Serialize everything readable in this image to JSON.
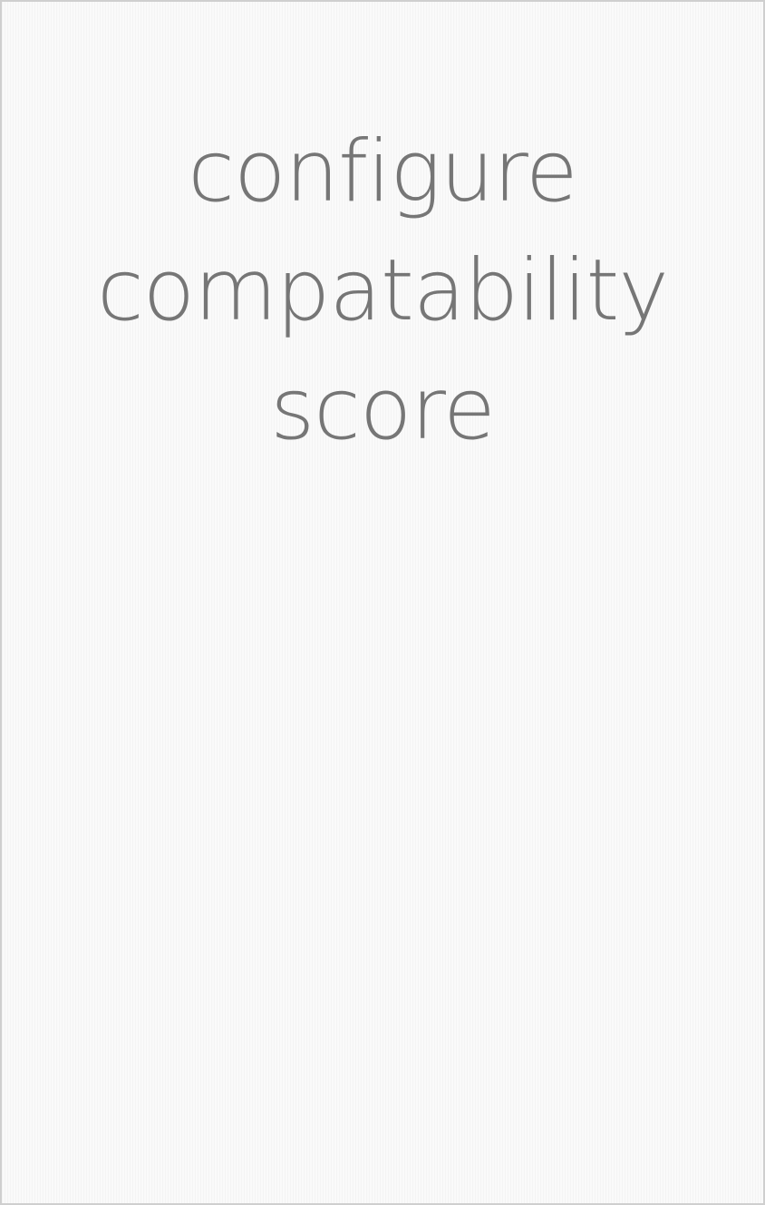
{
  "screen": {
    "title_lines": [
      "configure",
      "compatability",
      "score"
    ]
  },
  "colors": {
    "title_text": "#767676",
    "background": "#fafafa",
    "border": "#cfcfcf"
  }
}
